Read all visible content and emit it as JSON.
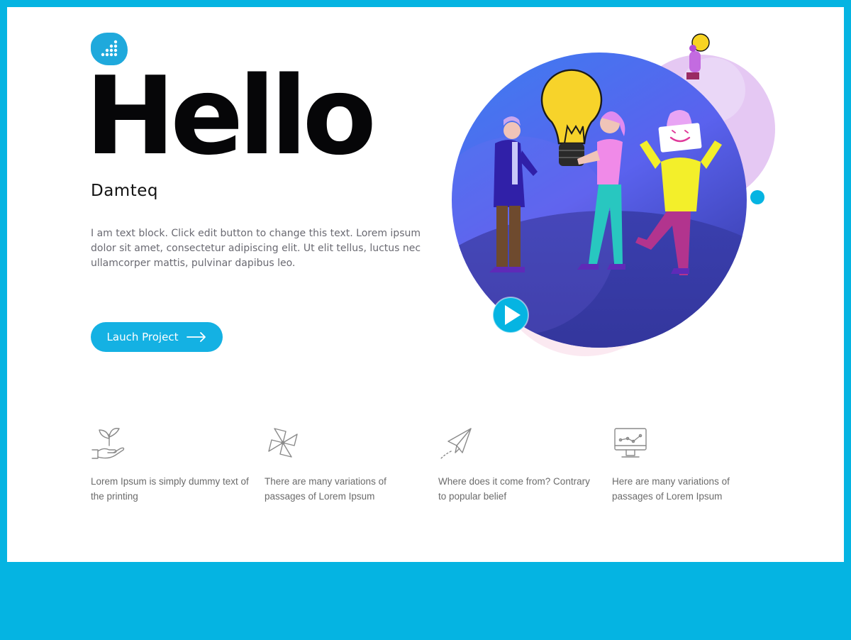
{
  "hero": {
    "title": "Hello",
    "brand": "Damteq",
    "body": "I am text block. Click edit button to change this text. Lorem ipsum dolor sit amet, consectetur adipiscing elit. Ut elit tellus, luctus nec ullamcorper mattis, pulvinar dapibus leo.",
    "cta_label": "Lauch Project",
    "cta_icon": "arrow-right-icon"
  },
  "logo": {
    "icon": "dot-grid-logo",
    "color": "#1fa9dc"
  },
  "illustration": {
    "description_icon": "team-lightbulb-illustration",
    "play_icon": "play-icon",
    "accent": "#05b4e2",
    "circle_color": "#4b6bf0"
  },
  "features": [
    {
      "icon": "hand-sprout-icon",
      "text": "Lorem Ipsum is simply dummy text of the printing"
    },
    {
      "icon": "pinwheel-icon",
      "text": "There are many variations of passages of Lorem Ipsum"
    },
    {
      "icon": "paper-plane-icon",
      "text": "Where does it come from? Contrary to popular belief"
    },
    {
      "icon": "monitor-chart-icon",
      "text": "Here are many variations of passages of Lorem Ipsum"
    }
  ],
  "colors": {
    "frame": "#05b4e2",
    "button": "#14b1e3",
    "text_dark": "#060608",
    "text_muted": "#6a6a72"
  }
}
